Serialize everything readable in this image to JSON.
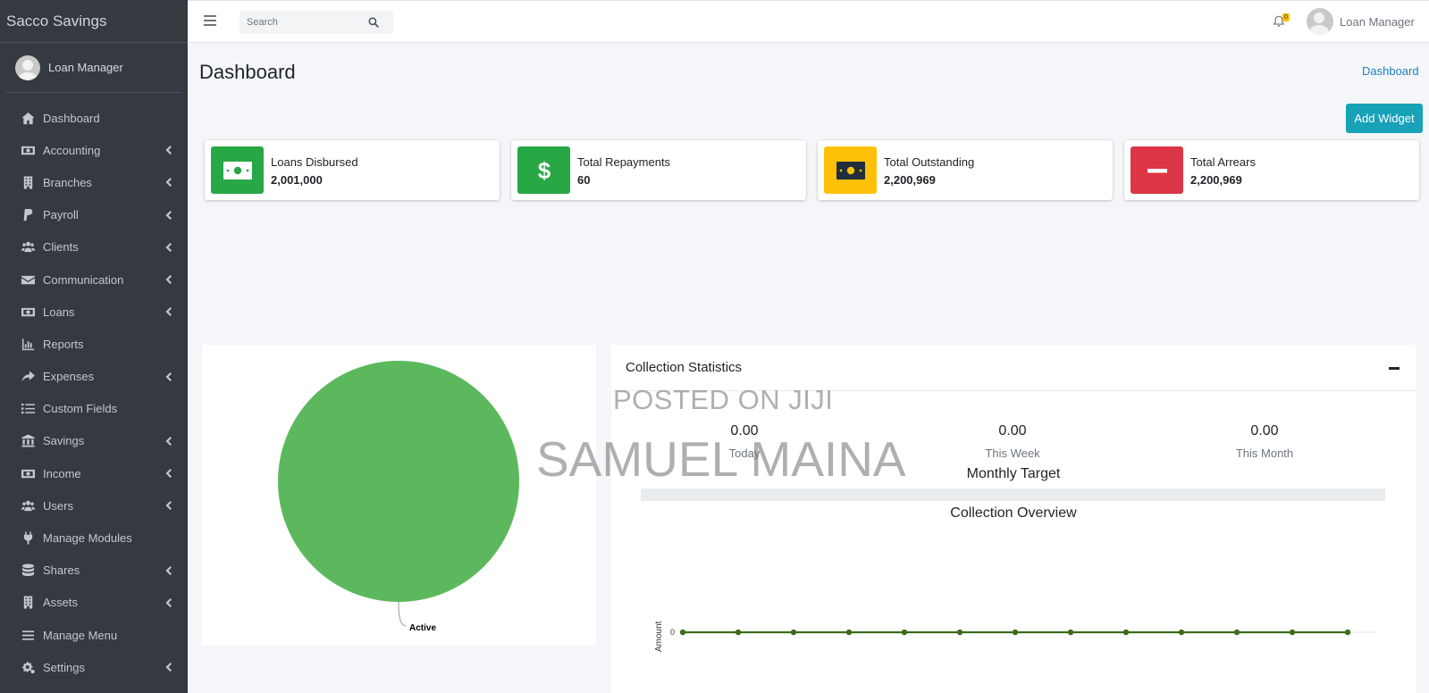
{
  "brand": "Sacco Savings",
  "user": {
    "name": "Loan Manager"
  },
  "sidebar": {
    "items": [
      {
        "label": "Dashboard",
        "icon": "home-icon",
        "has_children": false
      },
      {
        "label": "Accounting",
        "icon": "money-bill-icon",
        "has_children": true
      },
      {
        "label": "Branches",
        "icon": "building-icon",
        "has_children": true
      },
      {
        "label": "Payroll",
        "icon": "paypal-icon",
        "has_children": true
      },
      {
        "label": "Clients",
        "icon": "users-icon",
        "has_children": true
      },
      {
        "label": "Communication",
        "icon": "envelope-icon",
        "has_children": true
      },
      {
        "label": "Loans",
        "icon": "money-bill-icon",
        "has_children": true
      },
      {
        "label": "Reports",
        "icon": "chart-bar-icon",
        "has_children": false
      },
      {
        "label": "Expenses",
        "icon": "share-icon",
        "has_children": true
      },
      {
        "label": "Custom Fields",
        "icon": "list-icon",
        "has_children": false
      },
      {
        "label": "Savings",
        "icon": "university-icon",
        "has_children": true
      },
      {
        "label": "Income",
        "icon": "money-bill-icon",
        "has_children": true
      },
      {
        "label": "Users",
        "icon": "users-icon",
        "has_children": true
      },
      {
        "label": "Manage Modules",
        "icon": "plug-icon",
        "has_children": false
      },
      {
        "label": "Shares",
        "icon": "database-icon",
        "has_children": true
      },
      {
        "label": "Assets",
        "icon": "building-icon",
        "has_children": true
      },
      {
        "label": "Manage Menu",
        "icon": "bars-icon",
        "has_children": false
      },
      {
        "label": "Settings",
        "icon": "cogs-icon",
        "has_children": true
      }
    ]
  },
  "topbar": {
    "search_placeholder": "Search",
    "notification_count": "0",
    "user_name": "Loan Manager"
  },
  "page": {
    "title": "Dashboard",
    "breadcrumb": "Dashboard",
    "add_widget_label": "Add Widget"
  },
  "info_boxes": [
    {
      "label": "Loans Disbursed",
      "value": "2,001,000",
      "color": "#28a745",
      "icon": "money-bill-icon"
    },
    {
      "label": "Total Repayments",
      "value": "60",
      "color": "#28a745",
      "icon": "dollar-icon"
    },
    {
      "label": "Total Outstanding",
      "value": "2,200,969",
      "color": "#ffc107",
      "icon": "money-bill-icon"
    },
    {
      "label": "Total Arrears",
      "value": "2,200,969",
      "color": "#dc3545",
      "icon": "minus-icon"
    }
  ],
  "collection_statistics": {
    "title": "Collection Statistics",
    "stats": [
      {
        "value": "0.00",
        "label": "Today"
      },
      {
        "value": "0.00",
        "label": "This Week"
      },
      {
        "value": "0.00",
        "label": "This Month"
      }
    ],
    "monthly_target_label": "Monthly Target",
    "monthly_target_progress": 0,
    "overview_title": "Collection Overview"
  },
  "watermark": {
    "line1": "POSTED ON JIJI",
    "line2": "SAMUEL MAINA"
  },
  "chart_data": [
    {
      "type": "pie",
      "categories": [
        "Active"
      ],
      "values": [
        100
      ],
      "colors": [
        "#5cb85c"
      ]
    },
    {
      "type": "line",
      "title": "Collection Overview",
      "ylabel": "Amount",
      "ytick_labels": [
        "0"
      ],
      "series": [
        {
          "values": [
            0,
            0,
            0,
            0,
            0,
            0,
            0,
            0,
            0,
            0,
            0,
            0,
            0
          ],
          "color": "#3e6b1a"
        }
      ]
    }
  ]
}
